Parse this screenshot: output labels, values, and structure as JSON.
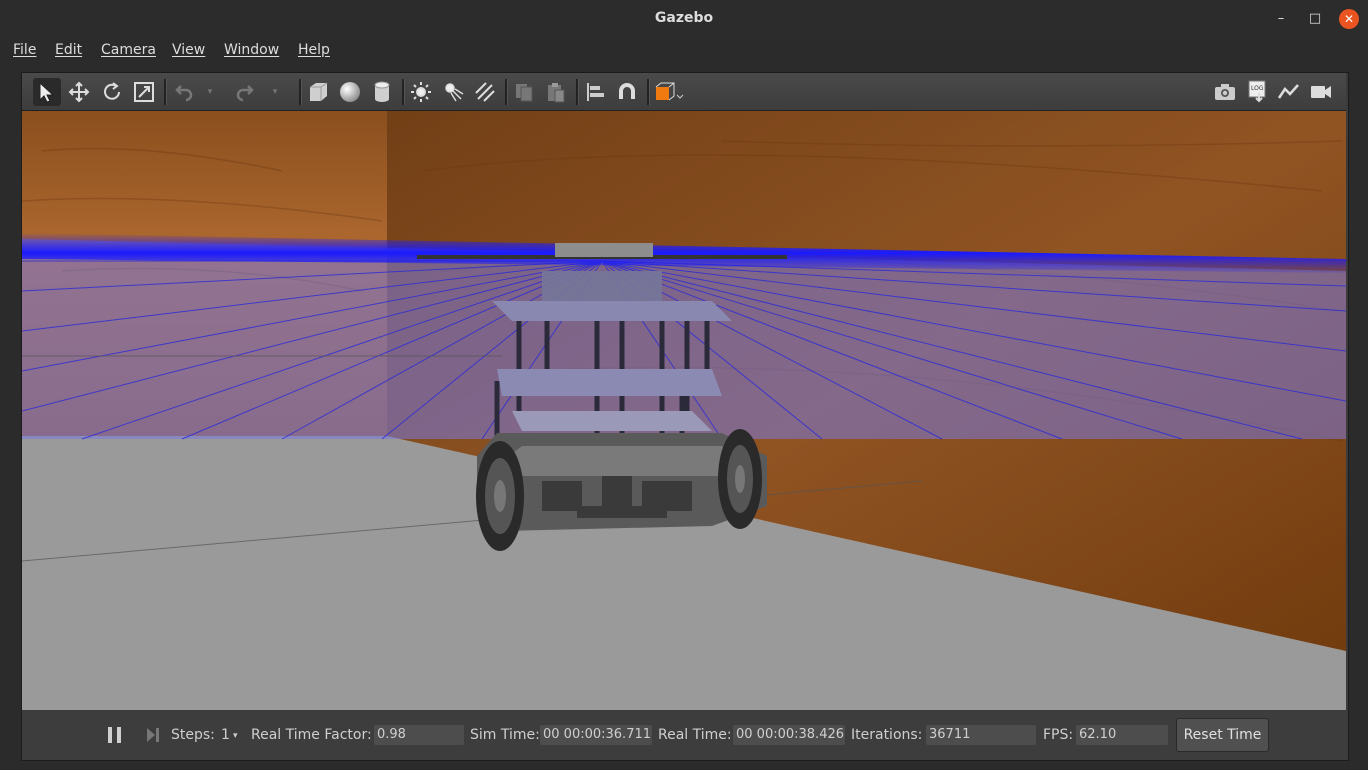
{
  "window": {
    "title": "Gazebo"
  },
  "menu": [
    "File",
    "Edit",
    "Camera",
    "View",
    "Window",
    "Help"
  ],
  "toolbar": {
    "left_tools": [
      "select-mode",
      "translate-mode",
      "rotate-mode",
      "scale-mode",
      "undo",
      "redo",
      "box",
      "sphere",
      "cylinder",
      "point-light",
      "spot-light",
      "directional-light",
      "copy",
      "paste",
      "align",
      "snap",
      "view-angle"
    ],
    "right_tools": [
      "screenshot",
      "log",
      "plot",
      "record-video"
    ]
  },
  "status": {
    "steps_label": "Steps:",
    "steps_value": "1",
    "rtf_label": "Real Time Factor:",
    "rtf_value": "0.98",
    "sim_time_label": "Sim Time:",
    "sim_time_value": "00 00:00:36.711",
    "real_time_label": "Real Time:",
    "real_time_value": "00 00:00:38.426",
    "iterations_label": "Iterations:",
    "iterations_value": "36711",
    "fps_label": "FPS:",
    "fps_value": "62.10",
    "reset_label": "Reset Time"
  },
  "colors": {
    "accent": "#e95420",
    "laser": "#1a1aff",
    "wood": "#9a5a26",
    "ground": "#9a9a9a",
    "laser_plane": "#9a9ad6"
  }
}
